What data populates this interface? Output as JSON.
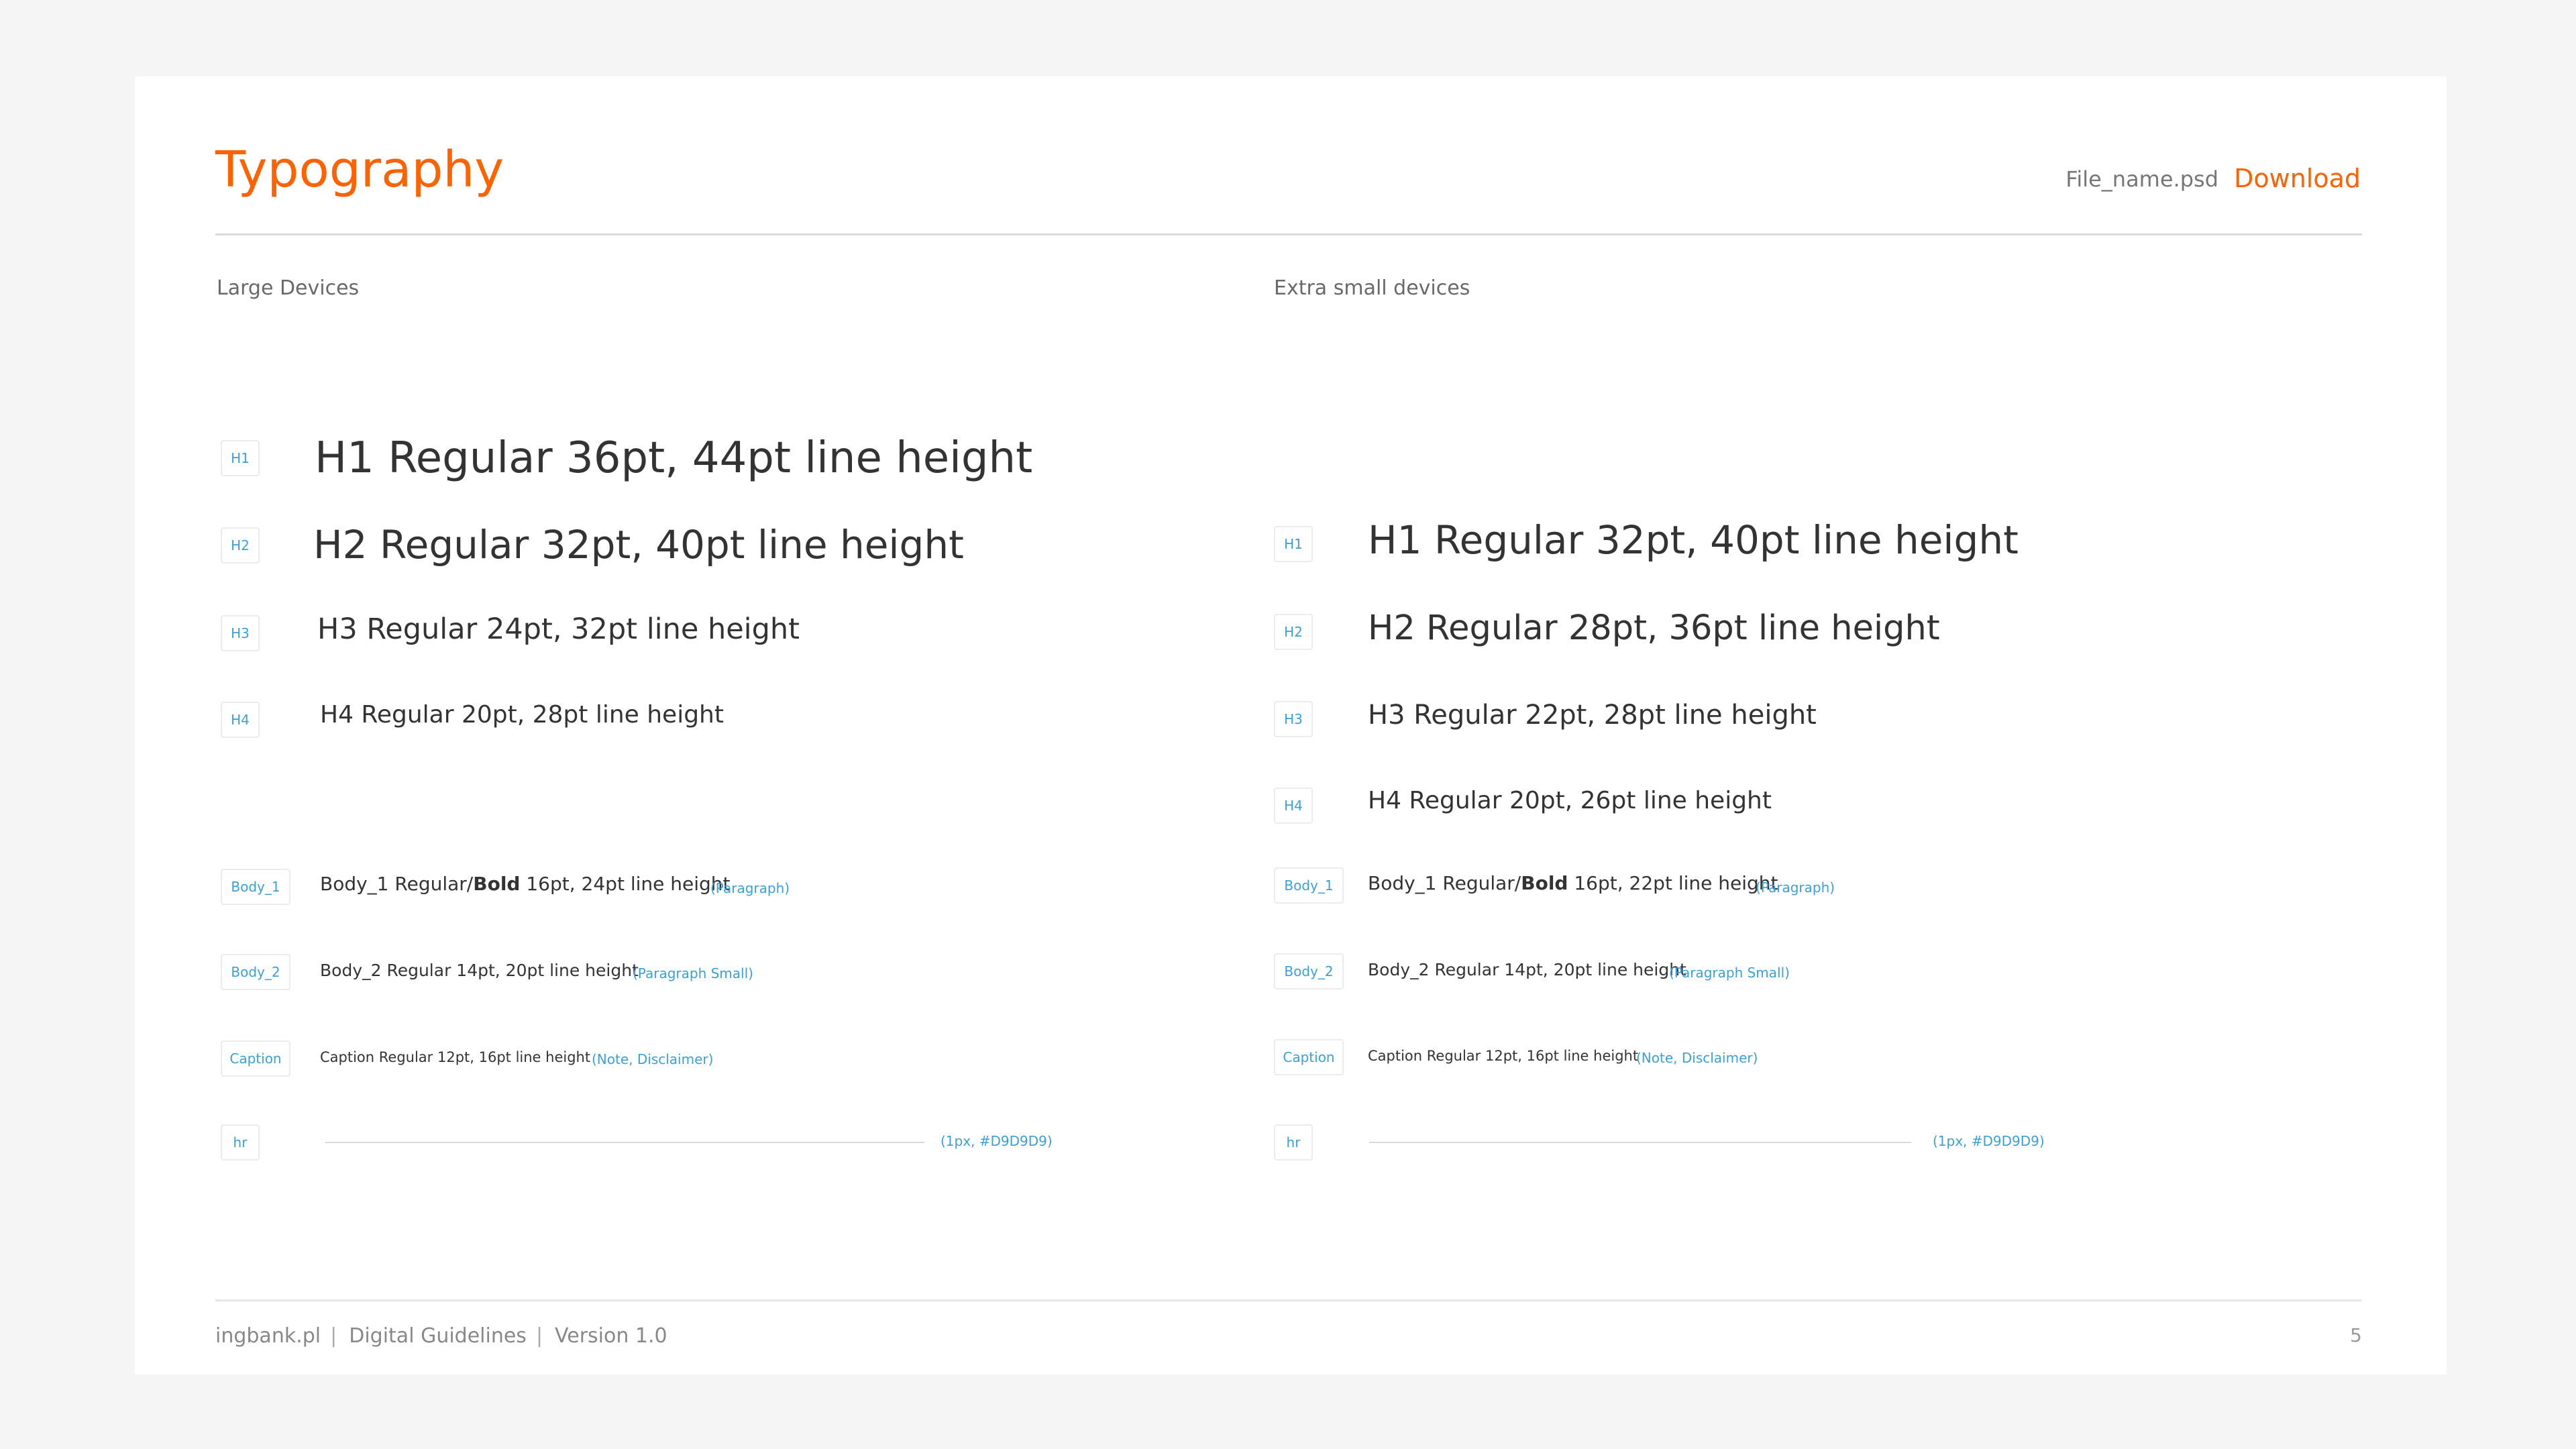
{
  "header": {
    "title": "Typography",
    "file_name": "File_name.psd",
    "download_label": "Download"
  },
  "columns": [
    {
      "heading": "Large Devices",
      "rows": [
        {
          "tag": "H1",
          "text": "H1 Regular 36pt, 44pt line height",
          "note": ""
        },
        {
          "tag": "H2",
          "text": "H2 Regular 32pt, 40pt line height",
          "note": ""
        },
        {
          "tag": "H3",
          "text": "H3 Regular 24pt, 32pt line height",
          "note": ""
        },
        {
          "tag": "H4",
          "text": "H4 Regular 20pt, 28pt line height",
          "note": ""
        },
        {
          "tag": "Body_1",
          "text_pre": "Body_1 Regular/",
          "text_bold": "Bold",
          "text_post": " 16pt, 24pt line height",
          "note": "(Paragraph)"
        },
        {
          "tag": "Body_2",
          "text": "Body_2 Regular 14pt, 20pt line height",
          "note": "(Paragraph Small)"
        },
        {
          "tag": "Caption",
          "text": "Caption Regular 12pt, 16pt line height",
          "note": "(Note, Disclaimer)"
        },
        {
          "tag": "hr",
          "text": "",
          "note": "(1px, #D9D9D9)"
        }
      ]
    },
    {
      "heading": "Extra small devices",
      "rows": [
        {
          "tag": "H1",
          "text": "H1 Regular 32pt, 40pt line height",
          "note": ""
        },
        {
          "tag": "H2",
          "text": "H2 Regular 28pt, 36pt line height",
          "note": ""
        },
        {
          "tag": "H3",
          "text": "H3 Regular 22pt, 28pt line height",
          "note": ""
        },
        {
          "tag": "H4",
          "text": "H4 Regular 20pt, 26pt line height",
          "note": ""
        },
        {
          "tag": "Body_1",
          "text_pre": "Body_1 Regular/",
          "text_bold": "Bold",
          "text_post": " 16pt, 22pt line height",
          "note": "(Paragraph)"
        },
        {
          "tag": "Body_2",
          "text": "Body_2 Regular 14pt, 20pt line height",
          "note": "(Paragraph Small)"
        },
        {
          "tag": "Caption",
          "text": "Caption Regular 12pt, 16pt line height",
          "note": "(Note, Disclaimer)"
        },
        {
          "tag": "hr",
          "text": "",
          "note": "(1px, #D9D9D9)"
        }
      ]
    }
  ],
  "footer": {
    "site": "ingbank.pl",
    "section": "Digital Guidelines",
    "version": "Version 1.0",
    "page_number": "5"
  },
  "colors": {
    "accent": "#ff6200",
    "tag_text": "#3aa0d8",
    "hr": "#D9D9D9",
    "background": "#f5f5f5"
  }
}
